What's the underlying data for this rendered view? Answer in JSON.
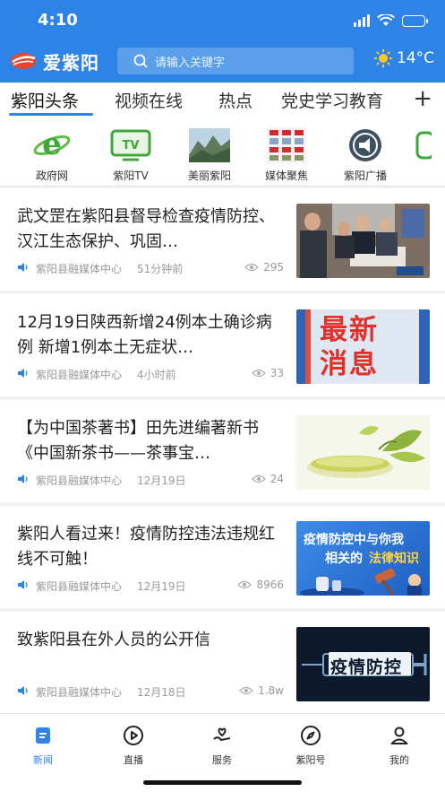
{
  "status": {
    "time": "4:10"
  },
  "header": {
    "logo_text": "爱紫阳",
    "search_placeholder": "请输入关键字",
    "temperature": "14°C",
    "weather_icon": "sun-icon",
    "accent": "#2d84e6"
  },
  "tabs": [
    {
      "label": "紫阳头条",
      "active": true
    },
    {
      "label": "视频在线"
    },
    {
      "label": "热点"
    },
    {
      "label": "党史学习教育"
    }
  ],
  "tab_add": "+",
  "channels": [
    {
      "label": "政府网",
      "icon": "ie-icon"
    },
    {
      "label": "紫阳TV",
      "icon": "tv-icon"
    },
    {
      "label": "美丽紫阳",
      "icon": "mountain-photo"
    },
    {
      "label": "媒体聚焦",
      "icon": "newspaper-icon"
    },
    {
      "label": "紫阳广播",
      "icon": "radio-icon"
    }
  ],
  "news": [
    {
      "title": "武文罡在紫阳县督导检查疫情防控、汉江生态保护、巩固…",
      "source": "紫阳县融媒体中心",
      "time": "51分钟前",
      "views": "295",
      "thumb": "meeting-photo"
    },
    {
      "title": "12月19日陕西新增24例本土确诊病例 新增1例本土无症状…",
      "source": "紫阳县融媒体中心",
      "time": "4小时前",
      "views": "33",
      "thumb": "latest-news-banner",
      "thumb_text": [
        "最新",
        "消息"
      ]
    },
    {
      "title": "【为中国茶著书】田先进编著新书《中国新茶书——茶事宝…",
      "source": "紫阳县融媒体中心",
      "time": "12月19日",
      "views": "24",
      "thumb": "tea-illustration"
    },
    {
      "title": "紫阳人看过来！疫情防控违法违规红线不可触！",
      "source": "紫阳县融媒体中心",
      "time": "12月19日",
      "views": "8966",
      "thumb": "law-banner",
      "thumb_text": [
        "疫情防控中与你我",
        "相关的",
        "法律知识"
      ]
    },
    {
      "title": "致紫阳县在外人员的公开信",
      "source": "紫阳县融媒体中心",
      "time": "12月18日",
      "views": "1.8w",
      "thumb": "epidemic-banner",
      "thumb_text": [
        "疫情防控"
      ]
    }
  ],
  "tabbar": [
    {
      "label": "新闻",
      "icon": "news-icon",
      "active": true
    },
    {
      "label": "直播",
      "icon": "play-icon"
    },
    {
      "label": "服务",
      "icon": "heart-hand-icon"
    },
    {
      "label": "紫阳号",
      "icon": "compass-icon"
    },
    {
      "label": "我的",
      "icon": "user-icon"
    }
  ]
}
